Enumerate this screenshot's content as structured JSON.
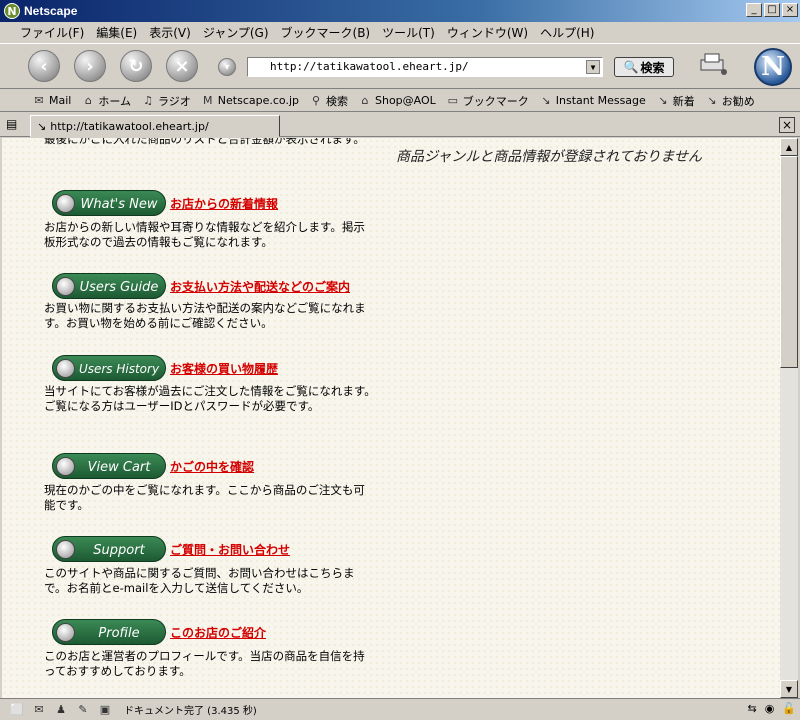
{
  "window": {
    "title": "Netscape"
  },
  "menubar": [
    "ファイル(F)",
    "編集(E)",
    "表示(V)",
    "ジャンプ(G)",
    "ブックマーク(B)",
    "ツール(T)",
    "ウィンドウ(W)",
    "ヘルプ(H)"
  ],
  "navbar": {
    "url": "http://tatikawatool.eheart.jp/",
    "search_label": "検索"
  },
  "personal_toolbar": [
    {
      "icon": "mail-icon",
      "label": "Mail"
    },
    {
      "icon": "home-icon",
      "label": "ホーム"
    },
    {
      "icon": "radio-icon",
      "label": "ラジオ"
    },
    {
      "icon": "my-netscape-icon",
      "label": "Netscape.co.jp"
    },
    {
      "icon": "search-icon",
      "label": "検索"
    },
    {
      "icon": "shop-icon",
      "label": "Shop@AOL"
    },
    {
      "icon": "bookmarks-icon",
      "label": "ブックマーク"
    },
    {
      "icon": "link-icon",
      "label": "Instant Message"
    },
    {
      "icon": "link-icon",
      "label": "新着"
    },
    {
      "icon": "link-icon",
      "label": "お勧め"
    }
  ],
  "tab": {
    "label": "http://tatikawatool.eheart.jp/"
  },
  "content": {
    "cut_text": "最後にかごに入れた商品のリストと合計金額が表示されます。",
    "right_message": "商品ジャンルと商品情報が登録されておりません",
    "sections": [
      {
        "button": "What's New",
        "link": "お店からの新着情報",
        "desc": "お店からの新しい情報や耳寄りな情報などを紹介します。掲示板形式なので過去の情報もご覧になれます。"
      },
      {
        "button": "Users Guide",
        "link": "お支払い方法や配送などのご案内",
        "desc": "お買い物に関するお支払い方法や配送の案内などご覧になれます。お買い物を始める前にご確認ください。"
      },
      {
        "button": "Users History",
        "link": "お客様の買い物履歴",
        "desc": "当サイトにてお客様が過去にご注文した情報をご覧になれます。ご覧になる方はユーザーIDとパスワードが必要です。"
      },
      {
        "button": "View Cart",
        "link": "かごの中を確認",
        "desc": "現在のかごの中をご覧になれます。ここから商品のご注文も可能です。"
      },
      {
        "button": "Support",
        "link": "ご質問・お問い合わせ",
        "desc": "このサイトや商品に関するご質問、お問い合わせはこちらまで。お名前とe-mailを入力して送信してください。"
      },
      {
        "button": "Profile",
        "link": "このお店のご紹介",
        "desc": "このお店と運営者のプロフィールです。当店の商品を自信を持っておすすめしております。"
      }
    ]
  },
  "status": {
    "text": "ドキュメント完了 (3.435 秒)"
  }
}
